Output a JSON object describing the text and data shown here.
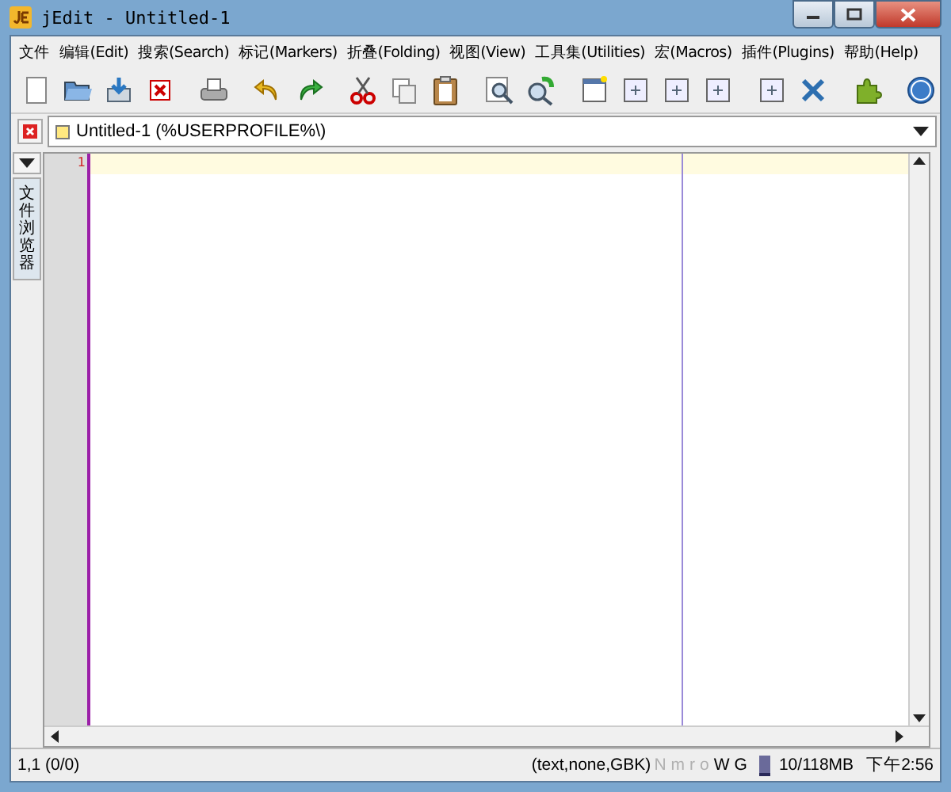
{
  "window": {
    "title": "jEdit - Untitled-1"
  },
  "menu": [
    "文件",
    "编辑(Edit)",
    "搜索(Search)",
    "标记(Markers)",
    "折叠(Folding)",
    "视图(View)",
    "工具集(Utilities)",
    "宏(Macros)",
    "插件(Plugins)",
    "帮助(Help)"
  ],
  "buffer_tab": {
    "label": "Untitled-1 (%USERPROFILE%\\)"
  },
  "side_dock": {
    "label": "文件浏览器"
  },
  "editor": {
    "line_numbers": [
      "1"
    ]
  },
  "status_bar": {
    "position": "1,1 (0/0)",
    "mode": "(text,none,GBK)",
    "flags": [
      {
        "label": "N",
        "on": false
      },
      {
        "label": "m",
        "on": false
      },
      {
        "label": "r",
        "on": false
      },
      {
        "label": "o",
        "on": false
      },
      {
        "label": "W",
        "on": true
      },
      {
        "label": "G",
        "on": true
      }
    ],
    "memory": {
      "label": "10/118MB",
      "level": 0.09
    },
    "clock": "下午2:56"
  }
}
